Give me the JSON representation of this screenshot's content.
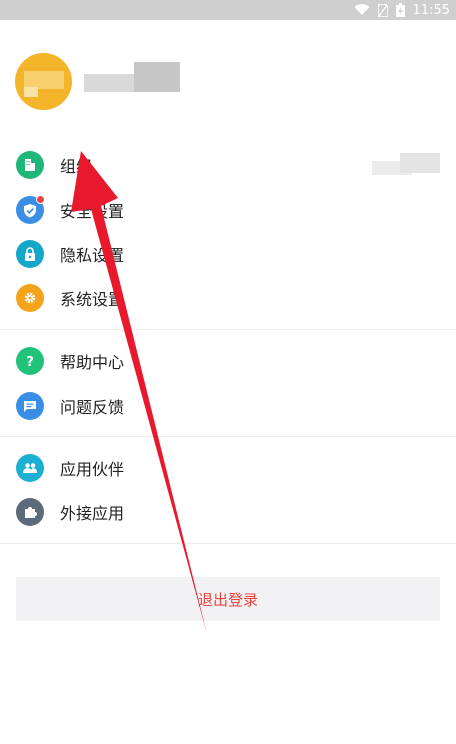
{
  "status_bar": {
    "time": "11:55"
  },
  "profile": {
    "name": ""
  },
  "menu": [
    {
      "label": "组织",
      "icon": "building-icon",
      "color": "#1fb67a"
    },
    {
      "label": "安全设置",
      "icon": "shield-icon",
      "color": "#3a8ee6"
    },
    {
      "label": "隐私设置",
      "icon": "lock-icon",
      "color": "#13a7c9"
    },
    {
      "label": "系统设置",
      "icon": "gear-icon",
      "color": "#f5a31b"
    },
    {
      "label": "帮助中心",
      "icon": "question-icon",
      "color": "#21c27a"
    },
    {
      "label": "问题反馈",
      "icon": "feedback-icon",
      "color": "#3a8ee6"
    },
    {
      "label": "应用伙伴",
      "icon": "partners-icon",
      "color": "#1bb0d2"
    },
    {
      "label": "外接应用",
      "icon": "puzzle-icon",
      "color": "#5b6b7a"
    }
  ],
  "logout_label": "退出登录",
  "colors": {
    "accent_red": "#e8453c",
    "annotation_arrow": "#e8192c"
  }
}
